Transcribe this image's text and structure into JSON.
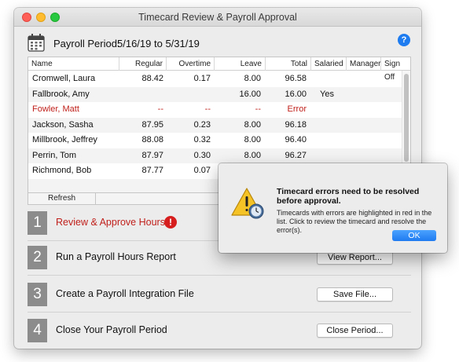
{
  "window": {
    "title": "Timecard Review & Payroll Approval"
  },
  "header": {
    "period_label": "Payroll Period:",
    "period_value": "5/16/19 to 5/31/19",
    "help": "?"
  },
  "table": {
    "columns": [
      "Name",
      "Regular",
      "Overtime",
      "Leave",
      "Total",
      "Salaried",
      "Manager",
      "Sign Off"
    ],
    "rows": [
      {
        "name": "Cromwell, Laura",
        "regular": "88.42",
        "overtime": "0.17",
        "leave": "8.00",
        "total": "96.58",
        "salaried": "",
        "manager": "",
        "signoff": ""
      },
      {
        "name": "Fallbrook, Amy",
        "regular": "",
        "overtime": "",
        "leave": "16.00",
        "total": "16.00",
        "salaried": "Yes",
        "manager": "",
        "signoff": ""
      },
      {
        "name": "Fowler, Matt",
        "regular": "--",
        "overtime": "--",
        "leave": "--",
        "total": "Error",
        "salaried": "",
        "manager": "",
        "signoff": ""
      },
      {
        "name": "Jackson, Sasha",
        "regular": "87.95",
        "overtime": "0.23",
        "leave": "8.00",
        "total": "96.18",
        "salaried": "",
        "manager": "",
        "signoff": ""
      },
      {
        "name": "Millbrook, Jeffrey",
        "regular": "88.08",
        "overtime": "0.32",
        "leave": "8.00",
        "total": "96.40",
        "salaried": "",
        "manager": "",
        "signoff": ""
      },
      {
        "name": "Perrin, Tom",
        "regular": "87.97",
        "overtime": "0.30",
        "leave": "8.00",
        "total": "96.27",
        "salaried": "",
        "manager": "",
        "signoff": ""
      },
      {
        "name": "Richmond, Bob",
        "regular": "87.77",
        "overtime": "0.07",
        "leave": "",
        "total": "",
        "salaried": "",
        "manager": "",
        "signoff": ""
      }
    ],
    "refresh_label": "Refresh",
    "error_color": "#c0201b"
  },
  "steps": [
    {
      "number": "1",
      "label": "Review & Approve Hours",
      "alert": "!",
      "button": ""
    },
    {
      "number": "2",
      "label": "Run a Payroll Hours Report",
      "button": "View Report..."
    },
    {
      "number": "3",
      "label": "Create a Payroll Integration File",
      "button": "Save File..."
    },
    {
      "number": "4",
      "label": "Close Your Payroll Period",
      "button": "Close Period..."
    }
  ],
  "dialog": {
    "title": "Timecard errors need to be resolved before approval.",
    "message": "Timecards with errors are highlighted in red in the list. Click to review the timecard and resolve the error(s).",
    "ok_label": "OK",
    "icon": "warning-icon"
  },
  "colors": {
    "accent": "#1f7bf0",
    "error": "#c0201b",
    "step_badge": "#8c8c8c"
  }
}
